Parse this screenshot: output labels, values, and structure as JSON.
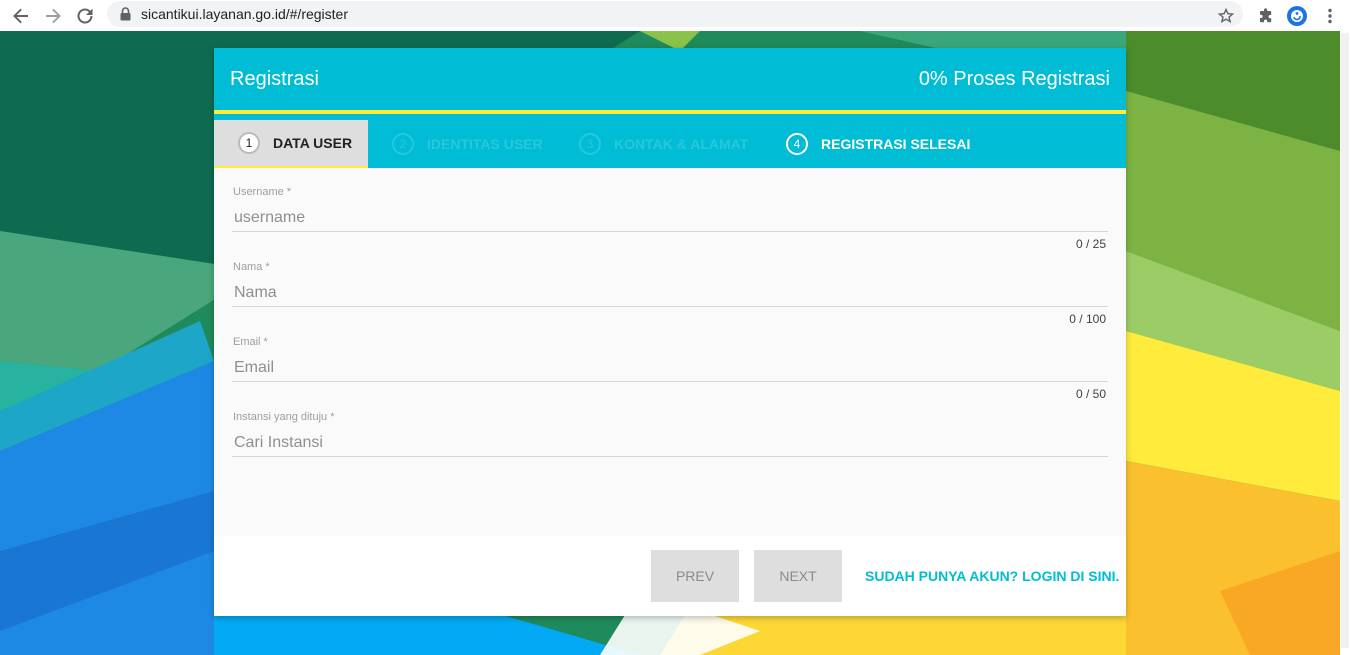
{
  "browser": {
    "url": "sicantikui.layanan.go.id/#/register"
  },
  "card": {
    "title": "Registrasi",
    "progress_text": "0% Proses Registrasi"
  },
  "steps": [
    {
      "number": "1",
      "label": "DATA USER",
      "state": "active"
    },
    {
      "number": "2",
      "label": "IDENTITAS USER",
      "state": "disabled"
    },
    {
      "number": "3",
      "label": "KONTAK & ALAMAT",
      "state": "disabled"
    },
    {
      "number": "4",
      "label": "REGISTRASI SELESAI",
      "state": "enabled"
    }
  ],
  "form": {
    "username": {
      "label": "Username *",
      "placeholder": "username",
      "counter": "0 / 25"
    },
    "nama": {
      "label": "Nama *",
      "placeholder": "Nama",
      "counter": "0 / 100"
    },
    "email": {
      "label": "Email *",
      "placeholder": "Email",
      "counter": "0 / 50"
    },
    "instansi": {
      "label": "Instansi yang dituju *",
      "placeholder": "Cari Instansi"
    }
  },
  "footer": {
    "prev_label": "PREV",
    "next_label": "NEXT",
    "login_link": "SUDAH PUNYA AKUN? LOGIN DI SINI."
  },
  "colors": {
    "primary": "#00bcd4",
    "accent": "#ffeb3b",
    "button_bg": "#dedede"
  }
}
